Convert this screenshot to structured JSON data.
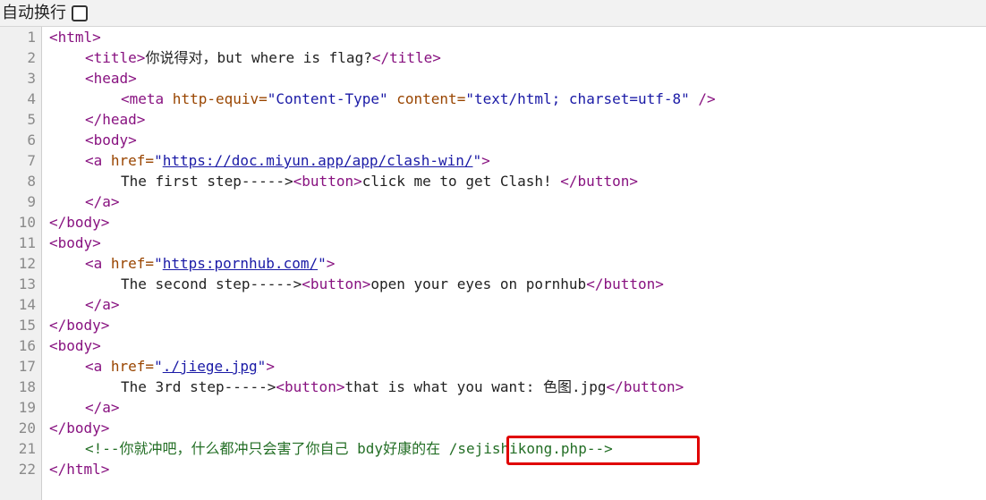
{
  "toolbar": {
    "wrap_label": "自动换行"
  },
  "line_numbers": [
    "1",
    "2",
    "3",
    "4",
    "5",
    "6",
    "7",
    "8",
    "9",
    "10",
    "11",
    "12",
    "13",
    "14",
    "15",
    "16",
    "17",
    "18",
    "19",
    "20",
    "21",
    "22"
  ],
  "source": {
    "l1": "<html>",
    "l2_open": "<title>",
    "l2_text": "你说得对，but where is flag?",
    "l2_close": "</title>",
    "l3": "<head>",
    "l4_open": "<meta",
    "l4_attr1": " http-equiv=",
    "l4_val1": "\"Content-Type\"",
    "l4_attr2": " content=",
    "l4_val2": "\"text/html; charset=utf-8\"",
    "l4_close": " />",
    "l5": "</head>",
    "l6": "<body>",
    "l7_open": "<a",
    "l7_attr": " href=",
    "l7_q1": "\"",
    "l7_link": "https://doc.miyun.app/app/clash-win/",
    "l7_q2": "\"",
    "l7_close": ">",
    "l8_text": "The first step----->",
    "l8_btn_open": "<button>",
    "l8_btn_text": "click me to get Clash! ",
    "l8_btn_close": "</button>",
    "l9": "</a>",
    "l10": "</body>",
    "l11": "<body>",
    "l12_open": "<a",
    "l12_attr": " href=",
    "l12_q1": "\"",
    "l12_link": "https:pornhub.com/",
    "l12_q2": "\"",
    "l12_close": ">",
    "l13_text": "The second step----->",
    "l13_btn_open": "<button>",
    "l13_btn_text": "open your eyes on pornhub",
    "l13_btn_close": "</button>",
    "l14": "</a>",
    "l15": "</body>",
    "l16": "<body>",
    "l17_open": "<a",
    "l17_attr": " href=",
    "l17_q1": "\"",
    "l17_link": "./jiege.jpg",
    "l17_q2": "\"",
    "l17_close": ">",
    "l18_text": "The 3rd step----->",
    "l18_btn_open": "<button>",
    "l18_btn_text": "that is what you want: 色图.jpg",
    "l18_btn_close": "</button>",
    "l19": "</a>",
    "l20": "</body>",
    "l21_comment": "<!--你就冲吧，什么都冲只会害了你自己 bdy好康的在 /sejishikong.php-->",
    "l22": "</html>"
  },
  "colors": {
    "tag": "#881280",
    "attribute": "#994500",
    "value": "#1a1aa6",
    "comment": "#236e25",
    "highlight_box": "#e00000"
  }
}
